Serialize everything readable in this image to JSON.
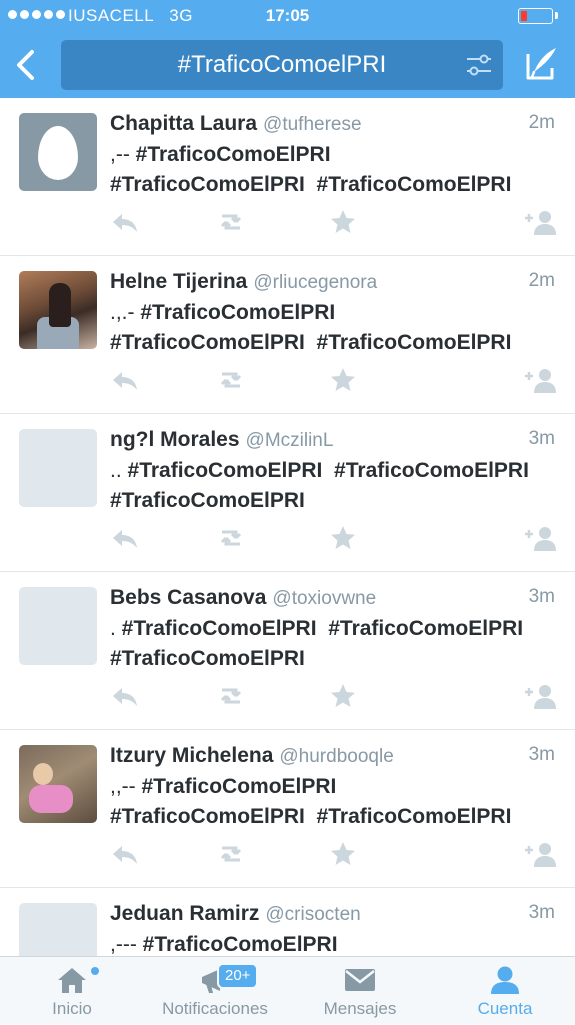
{
  "status_bar": {
    "carrier": "IUSACELL",
    "network": "3G",
    "time": "17:05"
  },
  "nav": {
    "search_query": "#TraficoComoelPRI",
    "back_icon": "chevron-left-icon",
    "filter_icon": "sliders-icon",
    "compose_icon": "compose-icon"
  },
  "tweets": [
    {
      "name": "Chapitta Laura",
      "handle": "@tufherese",
      "time": "2m",
      "avatar": "egg",
      "text_prefix": ",-- ",
      "text": "#TraficoComoElPRI\n#TraficoComoElPRI  #TraficoComoElPRI"
    },
    {
      "name": "Helne Tijerina",
      "handle": "@rliucegenora",
      "time": "2m",
      "avatar": "photo",
      "text_prefix": ".,.- ",
      "text": "#TraficoComoElPRI\n#TraficoComoElPRI  #TraficoComoElPRI"
    },
    {
      "name": "ng?l Morales",
      "handle": "@MczilinL",
      "time": "3m",
      "avatar": "blank",
      "text_prefix": ".. ",
      "text": "#TraficoComoElPRI  #TraficoComoElPRI\n#TraficoComoElPRI"
    },
    {
      "name": "Bebs Casanova",
      "handle": "@toxiovwne",
      "time": "3m",
      "avatar": "blank",
      "text_prefix": ". ",
      "text": "#TraficoComoElPRI  #TraficoComoElPRI\n#TraficoComoElPRI"
    },
    {
      "name": "Itzury Michelena",
      "handle": "@hurdbooqle",
      "time": "3m",
      "avatar": "photo",
      "text_prefix": ",,-- ",
      "text": "#TraficoComoElPRI\n#TraficoComoElPRI  #TraficoComoElPRI"
    },
    {
      "name": "Jeduan Ramirz",
      "handle": "@crisocten",
      "time": "3m",
      "avatar": "blank",
      "text_prefix": ",--- ",
      "text": "#TraficoComoElPRI"
    }
  ],
  "tabbar": {
    "home": "Inicio",
    "notifications": "Notificaciones",
    "notifications_badge": "20+",
    "messages": "Mensajes",
    "account": "Cuenta",
    "active": "account"
  },
  "colors": {
    "brand": "#55acee",
    "text": "#292f33",
    "muted": "#8899a6",
    "battery_low": "#ff3b30"
  }
}
